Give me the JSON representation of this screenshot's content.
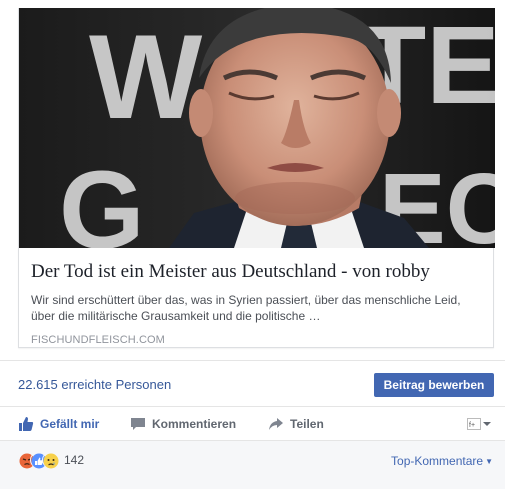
{
  "post": {
    "link_title": "Der Tod ist ein Meister aus Deutschland - von robby",
    "link_description_line1": "Wir sind erschüttert über das, was in Syrien passiert, über das menschliche Leid,",
    "link_description_line2": "über die militärische Grausamkeit und die politische …",
    "link_domain": "FISCHUNDFLEISCH.COM",
    "image_icon": "photo-man-eyes-closed"
  },
  "stats": {
    "reach_text": "22.615 erreichte Personen",
    "boost_label": "Beitrag bewerben"
  },
  "actions": {
    "like_label": "Gefällt mir",
    "comment_label": "Kommentieren",
    "share_label": "Teilen"
  },
  "reactions": {
    "icons": [
      "angry-icon",
      "like-icon",
      "sad-icon"
    ],
    "count": "142",
    "sort_label": "Top-Kommentare"
  },
  "colors": {
    "link_blue": "#365899",
    "button_blue": "#4267b2",
    "footer_bg": "#f6f7f9"
  }
}
